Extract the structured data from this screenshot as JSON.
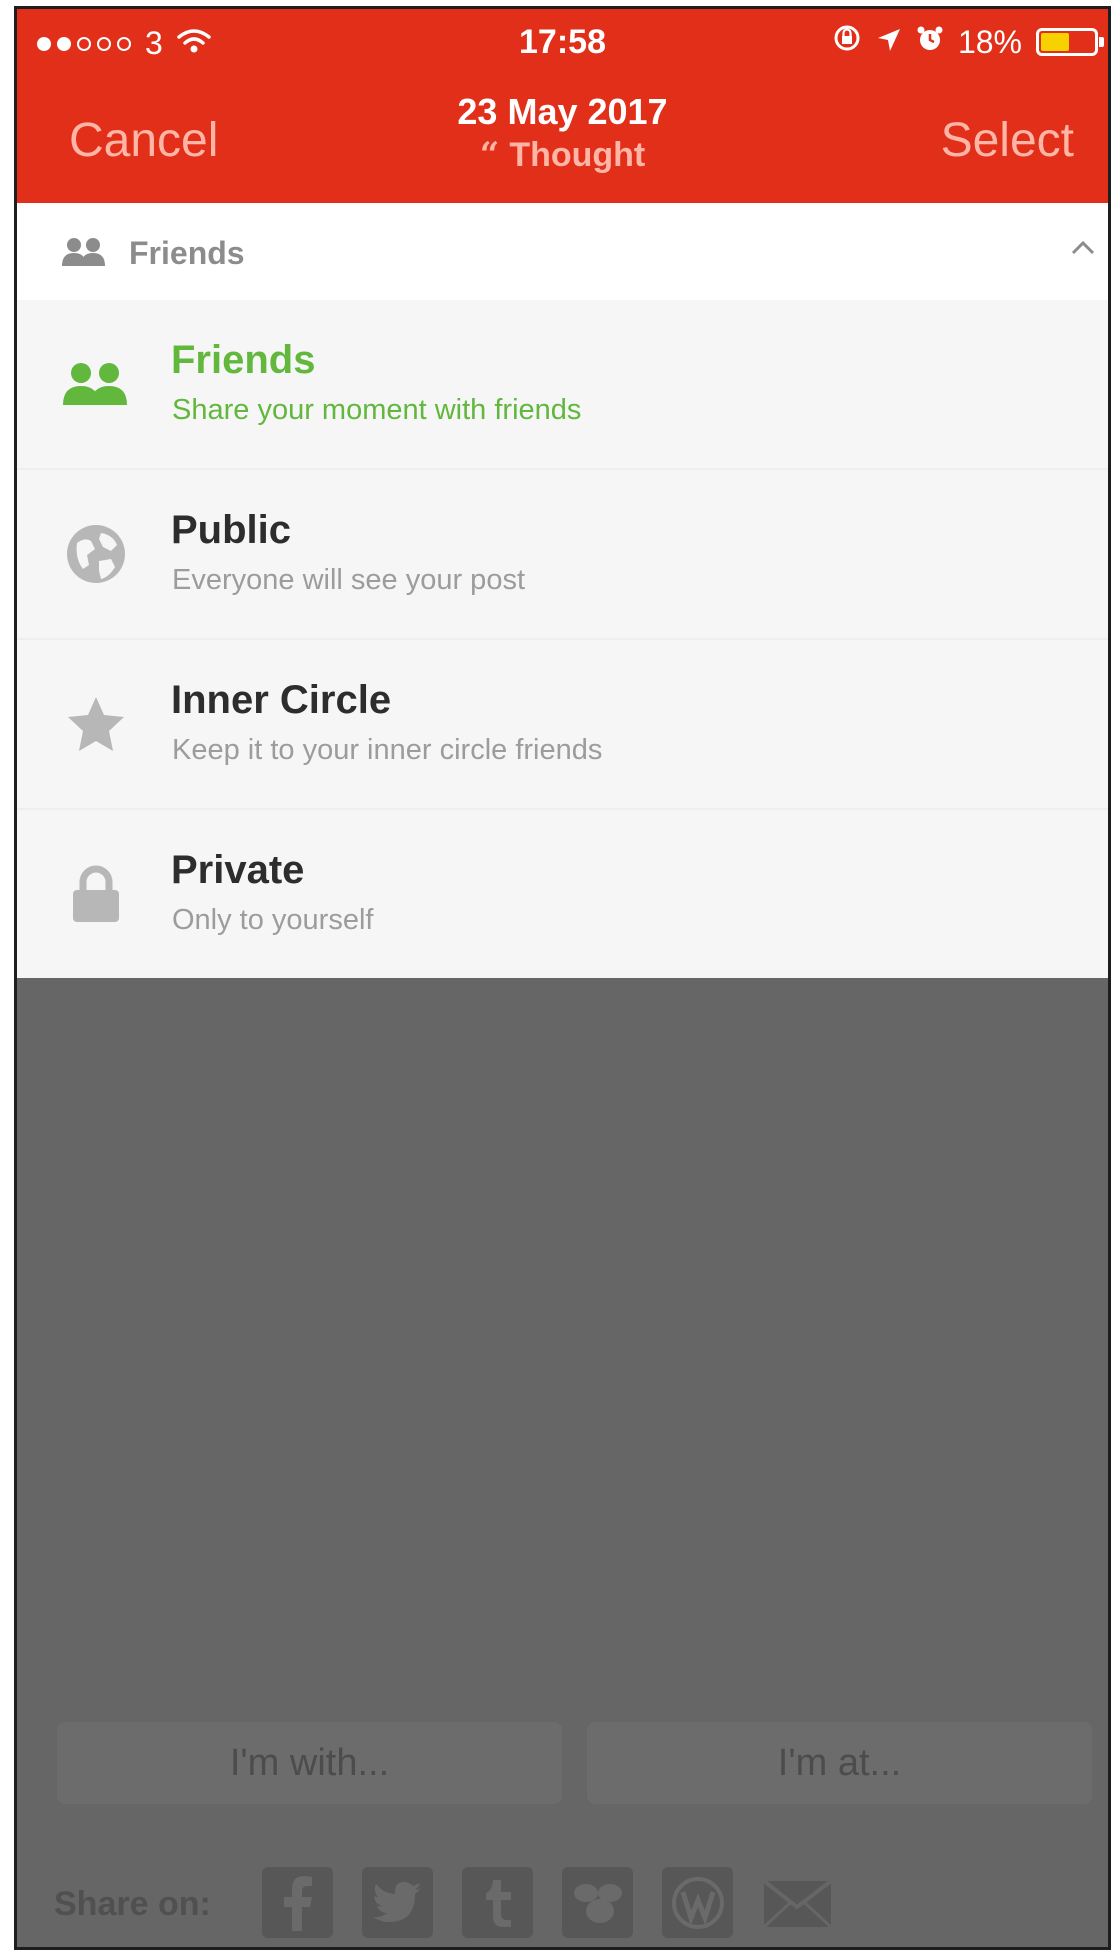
{
  "status_bar": {
    "carrier": "3",
    "time": "17:58",
    "battery": "18%",
    "battery_level": 0.18,
    "signal_bars_filled": 2,
    "signal_bars_total": 5
  },
  "header": {
    "cancel_label": "Cancel",
    "select_label": "Select",
    "date": "23 May 2017",
    "subtitle": "Thought",
    "quote_glyph": "“",
    "background_color": "#e22f1a"
  },
  "dropdown": {
    "current_label": "Friends",
    "icon": "two-users-icon",
    "chevron": "chevron-up-icon"
  },
  "options": [
    {
      "title": "Friends",
      "description": "Share your moment with friends",
      "icon": "two-users-icon",
      "selected": true,
      "color": "#62b73d"
    },
    {
      "title": "Public",
      "description": "Everyone will see your post",
      "icon": "globe-icon",
      "selected": false
    },
    {
      "title": "Inner Circle",
      "description": "Keep it to your inner circle friends",
      "icon": "star-icon",
      "selected": false
    },
    {
      "title": "Private",
      "description": "Only to yourself",
      "icon": "lock-icon",
      "selected": false
    }
  ],
  "tags": {
    "with_label": "I'm with...",
    "at_label": "I'm at..."
  },
  "share": {
    "label": "Share on:",
    "services": [
      "facebook-icon",
      "twitter-icon",
      "tumblr-icon",
      "swarm-icon",
      "wordpress-icon",
      "email-icon"
    ]
  }
}
